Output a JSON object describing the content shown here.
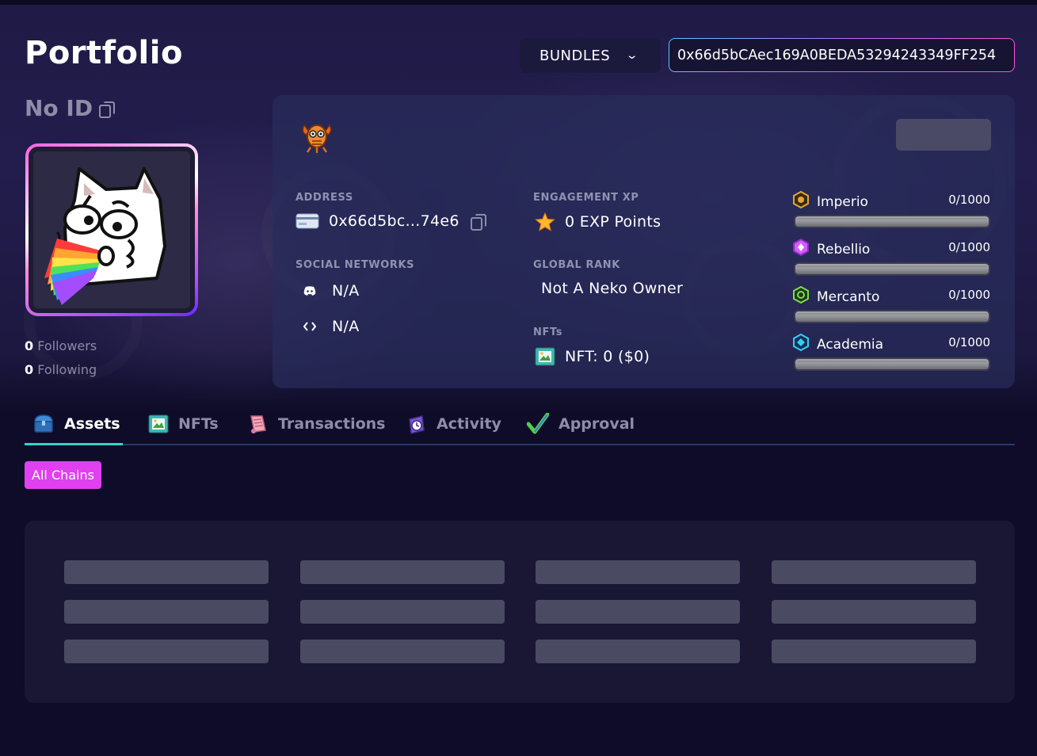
{
  "page": {
    "title": "Portfolio"
  },
  "header": {
    "bundles_label": "BUNDLES",
    "address_value": "0x66d5bCAec169A0BEDA53294243349FF254"
  },
  "profile": {
    "id_label": "No ID",
    "followers_count": "0",
    "followers_label": "Followers",
    "following_count": "0",
    "following_label": "Following"
  },
  "info": {
    "address_label": "ADDRESS",
    "address_value": "0x66d5bc...74e6",
    "social_label": "SOCIAL NETWORKS",
    "discord_value": "N/A",
    "other_social_value": "N/A",
    "xp_label": "ENGAGEMENT XP",
    "xp_value": "0 EXP Points",
    "rank_label": "GLOBAL RANK",
    "rank_value": "Not A Neko Owner",
    "nfts_label": "NFTs",
    "nfts_value": "NFT: 0 ($0)"
  },
  "factions": [
    {
      "name": "Imperio",
      "score": "0/1000",
      "progress": 0,
      "color": "#e0a83a"
    },
    {
      "name": "Rebellio",
      "score": "0/1000",
      "progress": 0,
      "color": "#d35cff"
    },
    {
      "name": "Mercanto",
      "score": "0/1000",
      "progress": 0,
      "color": "#7ed957"
    },
    {
      "name": "Academia",
      "score": "0/1000",
      "progress": 0,
      "color": "#3ec8ff"
    }
  ],
  "tabs": [
    {
      "label": "Assets",
      "icon": "treasure-chest-icon",
      "active": true
    },
    {
      "label": "NFTs",
      "icon": "picture-frame-icon",
      "active": false
    },
    {
      "label": "Transactions",
      "icon": "scroll-icon",
      "active": false
    },
    {
      "label": "Activity",
      "icon": "alarm-clock-icon",
      "active": false
    },
    {
      "label": "Approval",
      "icon": "checkmark-icon",
      "active": false
    }
  ],
  "filter": {
    "chip_label": "All Chains"
  },
  "colors": {
    "accent_chip": "#e040f0",
    "tab_underline": "#35d2c8",
    "background": "#0f0c29"
  }
}
